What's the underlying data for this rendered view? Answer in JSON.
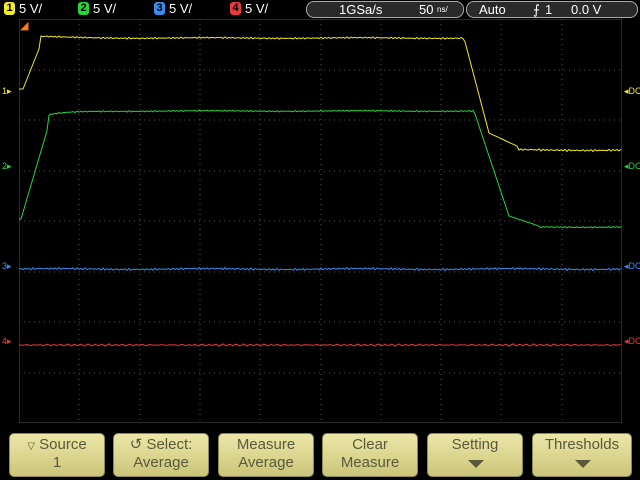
{
  "channels": [
    {
      "num": "1",
      "scale": "5 V/",
      "color": "#f2ea2a"
    },
    {
      "num": "2",
      "scale": "5 V/",
      "color": "#28d43a"
    },
    {
      "num": "3",
      "scale": "5 V/",
      "color": "#3a8df0"
    },
    {
      "num": "4",
      "scale": "5 V/",
      "color": "#e83a3a"
    }
  ],
  "acquisition": {
    "sample_rate": "1GSa/s",
    "timebase_value": "50",
    "timebase_unit": "ns/"
  },
  "trigger": {
    "mode": "Auto",
    "slope_symbol": "⨍",
    "source": "1",
    "level": "0.0 V"
  },
  "markers": {
    "ch1_ground": "1",
    "ch2_ground": "2",
    "ch3_ground": "3",
    "ch4_ground": "4",
    "trigger_level_icon": "trigger-level-arrow-icon",
    "coupling_labels": [
      "DC",
      "DC",
      "DC",
      "DC"
    ]
  },
  "softkeys": [
    {
      "line1": "Source",
      "line2": "1",
      "prefix": "▽"
    },
    {
      "line1": "Select:",
      "line2": "Average",
      "prefix": "↺"
    },
    {
      "line1": "Measure",
      "line2": "Average"
    },
    {
      "line1": "Clear",
      "line2": "Measure"
    },
    {
      "line1": "Setting",
      "line2": ""
    },
    {
      "line1": "Thresholds",
      "line2": ""
    }
  ]
}
